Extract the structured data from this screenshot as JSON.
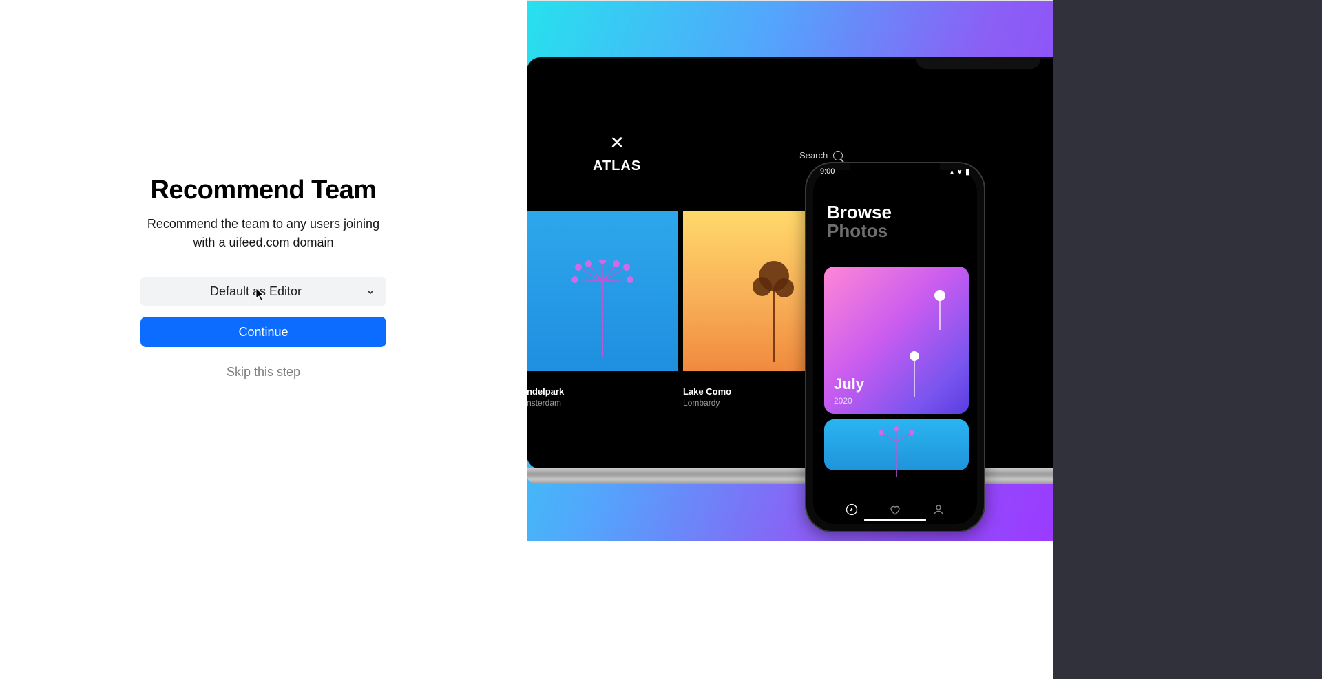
{
  "form": {
    "heading": "Recommend Team",
    "subheading": "Recommend the team to any users joining with a uifeed.com domain",
    "select_label": "Default as Editor",
    "cta_label": "Continue",
    "skip_label": "Skip this step"
  },
  "atlas": {
    "logo": "ATLAS",
    "search_label": "Search",
    "cards": [
      {
        "title": "ndelpark",
        "subtitle": "nsterdam"
      },
      {
        "title": "Lake Como",
        "subtitle": "Lombardy"
      }
    ]
  },
  "phone": {
    "time": "9:00",
    "heading_line1": "Browse",
    "heading_line2": "Photos",
    "card_month": "July",
    "card_year": "2020"
  }
}
